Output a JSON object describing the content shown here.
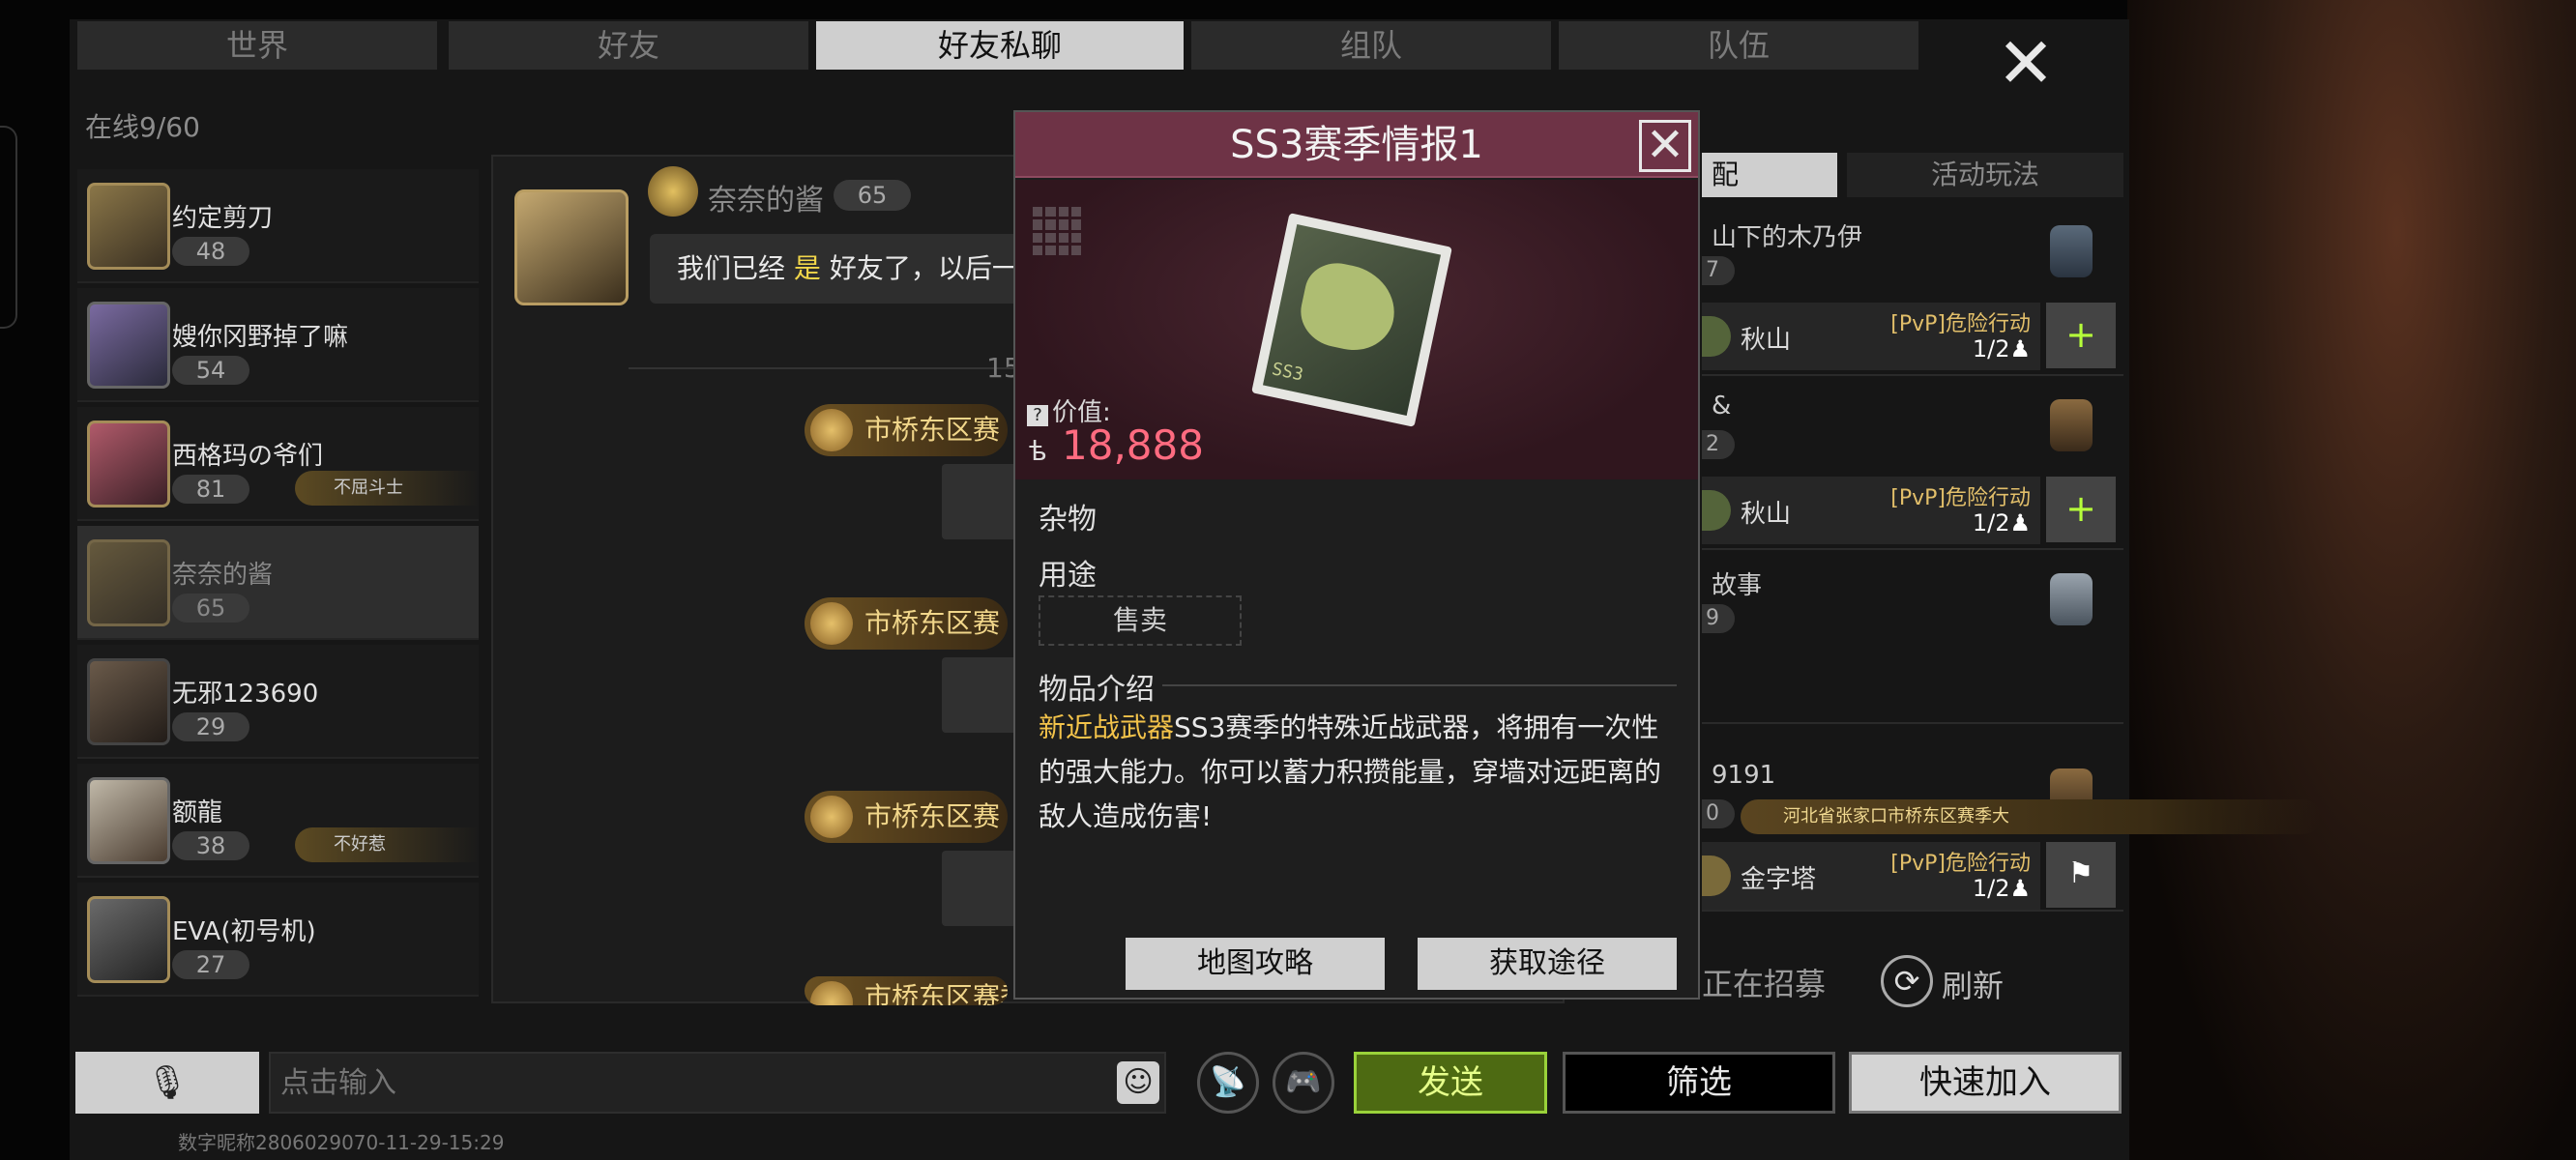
{
  "tabs": [
    "世界",
    "好友",
    "好友私聊",
    "组队",
    "队伍"
  ],
  "online": "在线9/60",
  "friends": [
    {
      "name": "约定剪刀",
      "level": "48",
      "tag": ""
    },
    {
      "name": "嫂你冈野掉了嘛",
      "level": "54",
      "tag": ""
    },
    {
      "name": "西格玛の爷们",
      "level": "81",
      "tag": "不屈斗士"
    },
    {
      "name": "奈奈的酱",
      "level": "65",
      "tag": ""
    },
    {
      "name": "无邪123690",
      "level": "29",
      "tag": ""
    },
    {
      "name": "额龍",
      "level": "38",
      "tag": "不好惹"
    },
    {
      "name": "EVA(初号机)",
      "level": "27",
      "tag": ""
    }
  ],
  "chat": {
    "sender": "奈奈的酱",
    "sender_level": "65",
    "message_part1": "我们已经",
    "message_yes": "是",
    "message_part2": "好友了，以后一",
    "time": "15",
    "location_msgs": [
      "市桥东区赛",
      "市桥东区赛",
      "市桥东区赛",
      "市桥东区赛季"
    ]
  },
  "right_panel": {
    "tab_match": "配",
    "tab_activity": "活动玩法",
    "teams": [
      {
        "name": "山下的木乃伊",
        "level": "7",
        "map": "秋山",
        "mode": "[PvP]危险行动",
        "count": "1/2",
        "action": "+"
      },
      {
        "name": "&",
        "level": "2",
        "map": "秋山",
        "mode": "[PvP]危险行动",
        "count": "1/2",
        "action": "+"
      },
      {
        "name": "故事",
        "level": "9",
        "map": "",
        "mode": "",
        "count": "",
        "action": ""
      },
      {
        "name": "9191",
        "level": "0",
        "location": "河北省张家口市桥东区赛季大",
        "map": "金字塔",
        "mode": "[PvP]危险行动",
        "count": "1/2",
        "action": "⚑"
      }
    ],
    "recruiting": "正在招募",
    "refresh": "刷新"
  },
  "bottom": {
    "input_placeholder": "点击输入",
    "send": "发送",
    "filter": "筛选",
    "quick_join": "快速加入",
    "footer": "数字昵称2806029070-11-29-15:29"
  },
  "modal": {
    "title": "SS3赛季情报1",
    "value_label": "价值:",
    "currency_symbol": "ѣ",
    "value": "18,888",
    "item_image_label": "SS3",
    "category": "杂物",
    "usage_label": "用途",
    "sell": "售卖",
    "intro_label": "物品介绍",
    "intro_highlight": "新近战武器",
    "intro_text": "SS3赛季的特殊近战武器，将拥有一次性的强大能力。你可以蓄力积攒能量，穿墙对远距离的敌人造成伤害!",
    "btn_map": "地图攻略",
    "btn_source": "获取途径"
  }
}
